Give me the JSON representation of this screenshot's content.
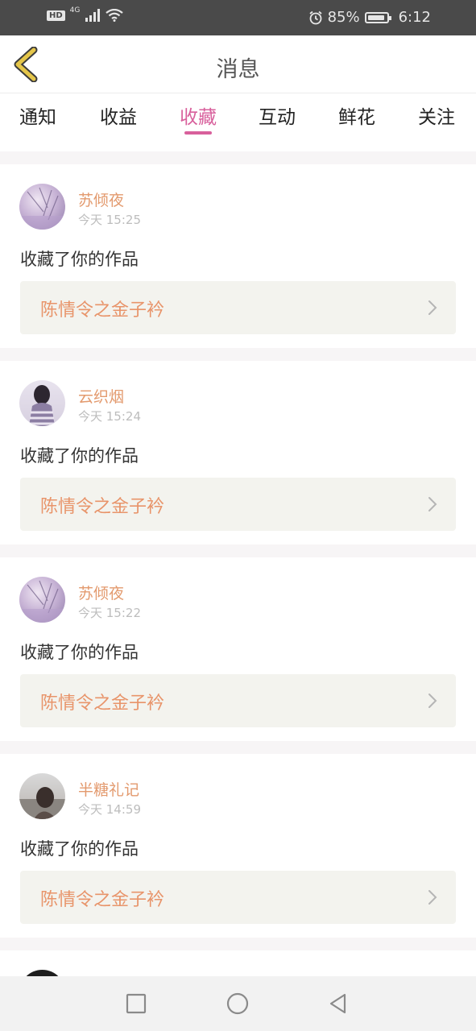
{
  "status_bar": {
    "hd_badge": "HD",
    "network": "4G",
    "battery": "85%",
    "time": "6:12",
    "icons": [
      "signal-icon",
      "wifi-icon",
      "alarm-icon",
      "battery-icon"
    ]
  },
  "header": {
    "title": "消息",
    "back_icon": "chevron-left-icon"
  },
  "tabs": [
    {
      "label": "通知",
      "active": false
    },
    {
      "label": "收益",
      "active": false
    },
    {
      "label": "收藏",
      "active": true
    },
    {
      "label": "互动",
      "active": false
    },
    {
      "label": "鲜花",
      "active": false
    },
    {
      "label": "关注",
      "active": false
    }
  ],
  "colors": {
    "accent": "#d8609c",
    "username": "#e39a6e",
    "work_title": "#e8946a",
    "work_bg": "#f3f3ee"
  },
  "notifications": [
    {
      "username": "苏倾夜",
      "time": "今天 15:25",
      "action": "收藏了你的作品",
      "work": "陈情令之金子衿"
    },
    {
      "username": "云织烟",
      "time": "今天 15:24",
      "action": "收藏了你的作品",
      "work": "陈情令之金子衿"
    },
    {
      "username": "苏倾夜",
      "time": "今天 15:22",
      "action": "收藏了你的作品",
      "work": "陈情令之金子衿"
    },
    {
      "username": "半糖礼记",
      "time": "今天 14:59",
      "action": "收藏了你的作品",
      "work": "陈情令之金子衿"
    }
  ],
  "nav_bar": {
    "icons": [
      "recent-apps-icon",
      "home-icon",
      "back-icon"
    ]
  }
}
